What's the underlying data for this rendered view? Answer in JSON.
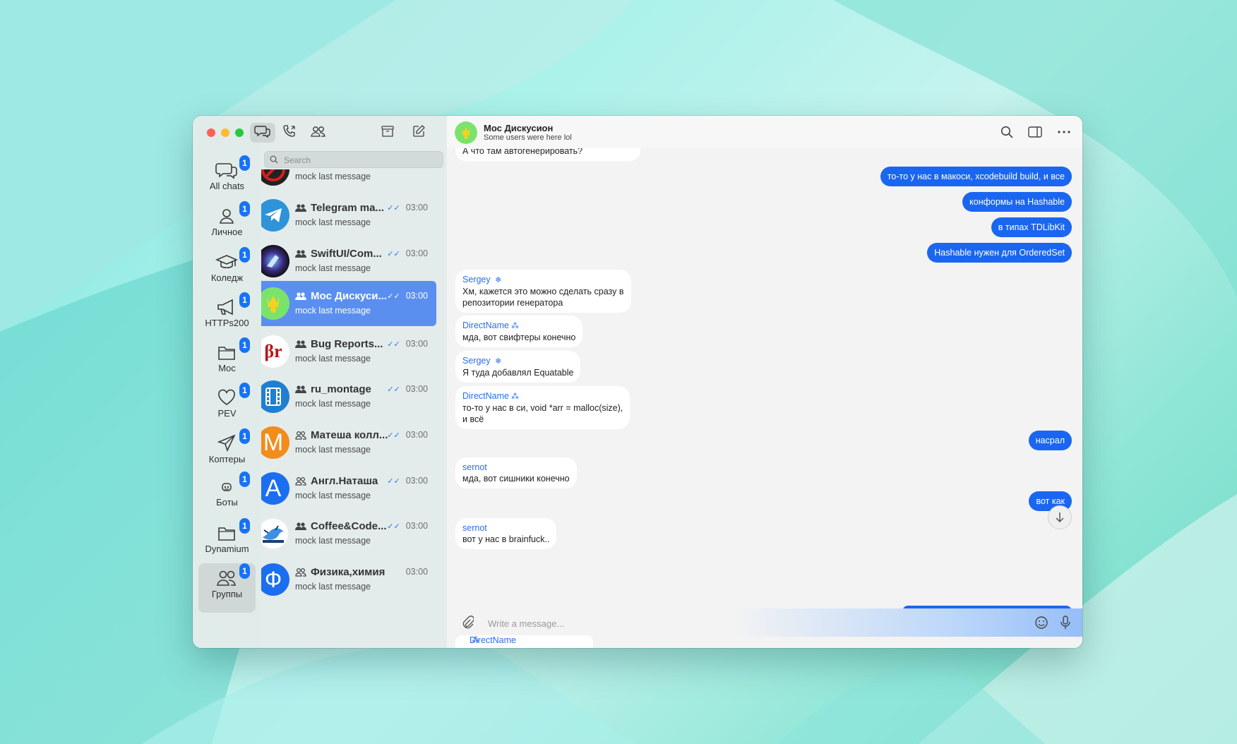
{
  "colors": {
    "accent": "#1b66f0",
    "badge": "#1673f5",
    "selected_row": "#5a8ff0",
    "traffic_close": "#fe5f57",
    "traffic_min": "#febc2e",
    "traffic_max": "#28c840"
  },
  "toolbar": {
    "chats_icon": "chat-bubbles-icon",
    "calls_icon": "phone-icon",
    "contacts_icon": "people-icon",
    "archive_icon": "archive-icon",
    "compose_icon": "compose-icon"
  },
  "search": {
    "placeholder": "Search"
  },
  "folders": [
    {
      "label": "All chats",
      "badge": "1",
      "icon": "chat-bubbles-icon"
    },
    {
      "label": "Личное",
      "badge": "1",
      "icon": "person-icon"
    },
    {
      "label": "Коледж",
      "badge": "1",
      "icon": "graduation-cap-icon"
    },
    {
      "label": "HTTPs200",
      "badge": "1",
      "icon": "megaphone-icon"
    },
    {
      "label": "Moc",
      "badge": "1",
      "icon": "folder-icon"
    },
    {
      "label": "PEV",
      "badge": "1",
      "icon": "heart-icon"
    },
    {
      "label": "Коптеры",
      "badge": "1",
      "icon": "paper-plane-icon"
    },
    {
      "label": "Боты",
      "badge": "1",
      "icon": "bot-icon"
    },
    {
      "label": "Dynamium",
      "badge": "1",
      "icon": "folder-icon"
    },
    {
      "label": "Группы",
      "badge": "1",
      "icon": "people-icon"
    }
  ],
  "chats": [
    {
      "title": "",
      "preview": "mock last message",
      "time": ""
    },
    {
      "title": "Telegram ma...",
      "preview": "mock last message",
      "time": "03:00"
    },
    {
      "title": "SwiftUI/Com...",
      "preview": "mock last message",
      "time": "03:00"
    },
    {
      "title": "Moc Дискуси...",
      "preview": "mock last message",
      "time": "03:00"
    },
    {
      "title": "Bug Reports...",
      "preview": "mock last message",
      "time": "03:00"
    },
    {
      "title": "ru_montage",
      "preview": "mock last message",
      "time": "03:00"
    },
    {
      "title": "Матеша колл...",
      "preview": "mock last message",
      "time": "03:00"
    },
    {
      "title": "Англ.Наташа",
      "preview": "mock last message",
      "time": "03:00"
    },
    {
      "title": "Coffee&Code...",
      "preview": "mock last message",
      "time": "03:00"
    },
    {
      "title": "Физика,химия",
      "preview": "mock last message",
      "time": "03:00"
    }
  ],
  "avatars": {
    "bug_reports": "βr",
    "matesha": "M",
    "angl": "A",
    "fizika": "Ф"
  },
  "header": {
    "title": "Мос Дискусион",
    "subtitle": "Some users were here lol",
    "search_icon": "search-icon",
    "sidebar_icon": "sidebar-toggle-icon",
    "more_icon": "more-icon"
  },
  "messages": {
    "m0": "А что там автогенерировать?",
    "o1": "то-то у нас в макоси, xcodebuild build, и все",
    "o2": "конформы на Hashable",
    "o3": "в типах TDLibKit",
    "o4": "Hashable нужен для OrderedSet",
    "m5_sender": "Sergey",
    "m5_text1": "Хм, кажется это можно сделать сразу в",
    "m5_text2": "репозитории генератора",
    "m6_sender": "DirectName",
    "m6_text": "мда, вот свифтеры конечно",
    "m7_sender": "Sergey",
    "m7_text": "Я туда добавлял Equatable",
    "m8_sender": "DirectName",
    "m8_text1": "то-то у нас в си, void *arr = malloc(size),",
    "m8_text2": "и всё",
    "o9": "насрал",
    "m10_sender": "sernot",
    "m10_text": "мда, вот сишники конечно",
    "o11": "вот как",
    "m12_sender": "sernot",
    "m12_text": "вот у нас в brainfuck..",
    "m13_sender": "DirectName"
  },
  "composer": {
    "placeholder": "Write a message..."
  }
}
